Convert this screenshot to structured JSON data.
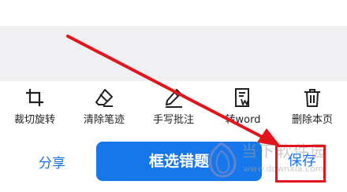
{
  "toolbar": {
    "items": [
      {
        "label": "裁切旋转",
        "icon": "crop-rotate-icon"
      },
      {
        "label": "清除笔迹",
        "icon": "eraser-icon"
      },
      {
        "label": "手写批注",
        "icon": "pen-icon"
      },
      {
        "label": "转word",
        "icon": "word-doc-icon"
      },
      {
        "label": "删除本页",
        "icon": "trash-icon"
      }
    ]
  },
  "bottom_bar": {
    "share_label": "分享",
    "primary_label": "框选错题",
    "save_label": "保存"
  },
  "watermark": {
    "chinese": "当下软件园",
    "url": "www.downxia.com"
  },
  "colors": {
    "accent": "#1677ea",
    "link": "#1a73e8",
    "annotation": "#e3141b",
    "band": "#f0f0f2"
  }
}
